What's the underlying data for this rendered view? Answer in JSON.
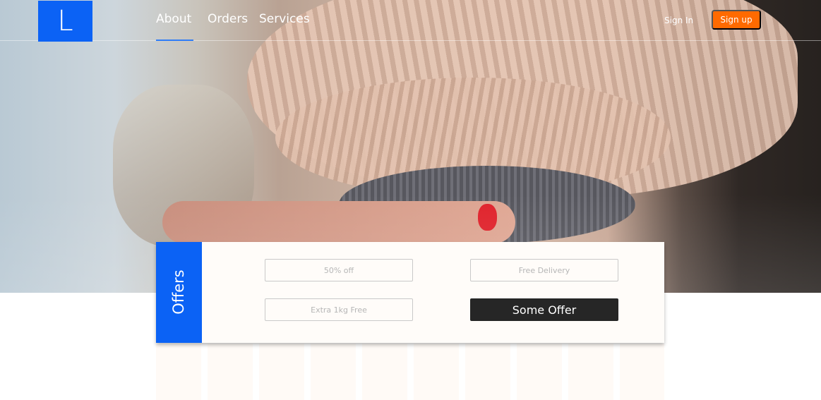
{
  "brand": {
    "logo_letter": "L",
    "logo_color": "#0b62f5"
  },
  "nav": {
    "items": [
      {
        "label": "About",
        "active": true
      },
      {
        "label": "Orders",
        "active": false
      },
      {
        "label": "Services",
        "active": false
      }
    ],
    "active_indicator_color": "#2f7df7"
  },
  "auth": {
    "sign_in_label": "Sign In",
    "sign_up_label": "Sign up",
    "sign_up_color": "#ff6a00"
  },
  "hero": {
    "image_description_icon": "sweater-photo"
  },
  "offers": {
    "title": "Offers",
    "title_bg_color": "#0b62f5",
    "items": [
      {
        "label": "50% off",
        "highlighted": false
      },
      {
        "label": "Free Delivery",
        "highlighted": false
      },
      {
        "label": "Extra 1kg Free",
        "highlighted": false
      },
      {
        "label": "Some Offer",
        "highlighted": true
      }
    ],
    "highlight_color": "#262626"
  }
}
